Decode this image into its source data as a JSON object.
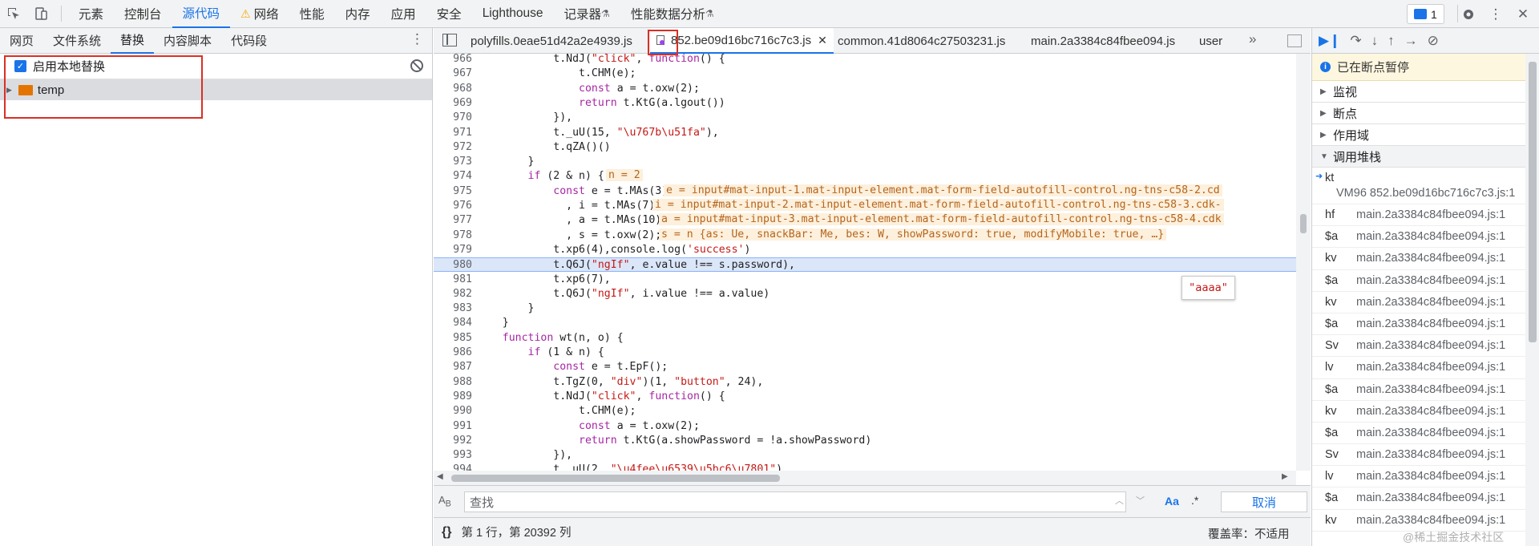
{
  "top_tabs": [
    "元素",
    "控制台",
    "源代码",
    "网络",
    "性能",
    "内存",
    "应用",
    "安全",
    "Lighthouse",
    "记录器",
    "性能数据分析"
  ],
  "active_top_tab": "源代码",
  "issues_count": "1",
  "left_tabs": [
    "网页",
    "文件系统",
    "替换",
    "内容脚本",
    "代码段"
  ],
  "enable_overrides_label": "启用本地替换",
  "folder_name": "temp",
  "file_tabs": [
    "polyfills.0eae51d42a2e4939.js",
    "852.be09d16bc716c7c3.js",
    "common.41d8064c27503231.js",
    "main.2a3384c84fbee094.js",
    "user"
  ],
  "code_lines": [
    {
      "n": "966",
      "code": "            t.NdJ(\"click\", function() {"
    },
    {
      "n": "967",
      "code": "                t.CHM(e);"
    },
    {
      "n": "968",
      "code": "                const a = t.oxw(2);"
    },
    {
      "n": "969",
      "code": "                return t.KtG(a.lgout())"
    },
    {
      "n": "970",
      "code": "            }),"
    },
    {
      "n": "971",
      "code": "            t._uU(15, \"\\u767b\\u51fa\"),"
    },
    {
      "n": "972",
      "code": "            t.qZA()()"
    },
    {
      "n": "973",
      "code": "        }"
    },
    {
      "n": "974",
      "code": "        if (2 & n) {"
    },
    {
      "n": "975",
      "code": "            const e = t.MAs(3)"
    },
    {
      "n": "976",
      "code": "              , i = t.MAs(7)"
    },
    {
      "n": "977",
      "code": "              , a = t.MAs(10)"
    },
    {
      "n": "978",
      "code": "              , s = t.oxw(2);"
    },
    {
      "n": "979",
      "code": "            t.xp6(4),console.log('success')"
    },
    {
      "n": "980",
      "code": "            t.Q6J(\"ngIf\", e.value !== s.password),"
    },
    {
      "n": "981",
      "code": "            t.xp6(7),"
    },
    {
      "n": "982",
      "code": "            t.Q6J(\"ngIf\", i.value !== a.value)"
    },
    {
      "n": "983",
      "code": "        }"
    },
    {
      "n": "984",
      "code": "    }"
    },
    {
      "n": "985",
      "code": "    function wt(n, o) {"
    },
    {
      "n": "986",
      "code": "        if (1 & n) {"
    },
    {
      "n": "987",
      "code": "            const e = t.EpF();"
    },
    {
      "n": "988",
      "code": "            t.TgZ(0, \"div\")(1, \"button\", 24),"
    },
    {
      "n": "989",
      "code": "            t.NdJ(\"click\", function() {"
    },
    {
      "n": "990",
      "code": "                t.CHM(e);"
    },
    {
      "n": "991",
      "code": "                const a = t.oxw(2);"
    },
    {
      "n": "992",
      "code": "                return t.KtG(a.showPassword = !a.showPassword)"
    },
    {
      "n": "993",
      "code": "            }),"
    },
    {
      "n": "994",
      "code": "            t._uU(2, \"\\u4fee\\u6539\\u5bc6\\u7801\"),"
    }
  ],
  "inline_values": [
    "n = 2",
    "e = input#mat-input-1.mat-input-element.mat-form-field-autofill-control.ng-tns-c58-2.cd",
    "i = input#mat-input-2.mat-input-element.mat-form-field-autofill-control.ng-tns-c58-3.cdk-",
    "a = input#mat-input-3.mat-input-element.mat-form-field-autofill-control.ng-tns-c58-4.cdk",
    "s = n {as: Ue, snackBar: Me, bes: W, showPassword: true, modifyMobile: true, …}"
  ],
  "tooltip_value": "\"aaaa\"",
  "search_placeholder": "查找",
  "cancel_label": "取消",
  "status_position": "第 1 行，第 20392 列",
  "coverage": "覆盖率：不适用",
  "paused_text": "已在断点暂停",
  "sections": [
    "监视",
    "断点",
    "作用域",
    "调用堆栈"
  ],
  "call_stack": [
    {
      "fn": "kt",
      "loc": "VM96 852.be09d16bc716c7c3.js:1"
    },
    {
      "fn": "hf",
      "loc": "main.2a3384c84fbee094.js:1"
    },
    {
      "fn": "$a",
      "loc": "main.2a3384c84fbee094.js:1"
    },
    {
      "fn": "kv",
      "loc": "main.2a3384c84fbee094.js:1"
    },
    {
      "fn": "$a",
      "loc": "main.2a3384c84fbee094.js:1"
    },
    {
      "fn": "kv",
      "loc": "main.2a3384c84fbee094.js:1"
    },
    {
      "fn": "$a",
      "loc": "main.2a3384c84fbee094.js:1"
    },
    {
      "fn": "Sv",
      "loc": "main.2a3384c84fbee094.js:1"
    },
    {
      "fn": "lv",
      "loc": "main.2a3384c84fbee094.js:1"
    },
    {
      "fn": "$a",
      "loc": "main.2a3384c84fbee094.js:1"
    },
    {
      "fn": "kv",
      "loc": "main.2a3384c84fbee094.js:1"
    },
    {
      "fn": "$a",
      "loc": "main.2a3384c84fbee094.js:1"
    },
    {
      "fn": "Sv",
      "loc": "main.2a3384c84fbee094.js:1"
    },
    {
      "fn": "lv",
      "loc": "main.2a3384c84fbee094.js:1"
    },
    {
      "fn": "$a",
      "loc": "main.2a3384c84fbee094.js:1"
    },
    {
      "fn": "kv",
      "loc": "main.2a3384c84fbee094.js:1"
    }
  ],
  "watermark": "@稀土掘金技术社区"
}
